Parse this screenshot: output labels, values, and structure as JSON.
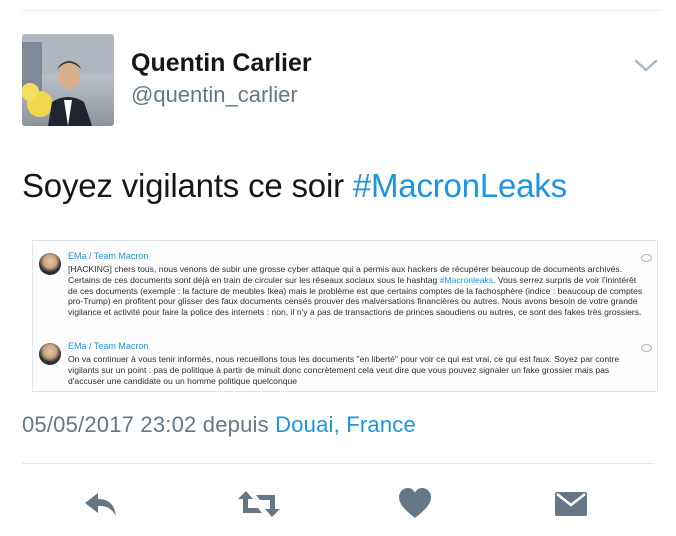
{
  "user": {
    "display_name": "Quentin Carlier",
    "handle": "@quentin_carlier"
  },
  "tweet": {
    "text_before": "Soyez vigilants ce soir ",
    "hashtag": "#MacronLeaks"
  },
  "embedded_messages": [
    {
      "author": "EMa / Team Macron",
      "body_before": "[HACKING] chers tous, nous venons de subir une grosse cyber attaque qui a permis aux hackers de récupérer beaucoup de documents archivés. Certains de ces documents sont déjà en train de circuler sur les réseaux sociaux sous le hashtag ",
      "hashtag": "#Macronleaks",
      "body_after": ". Vous serrez surpris de voir l'inintérêt de ces documents (exemple : la facture de meubles Ikea) mais le problème est que certains comptes de la fachosphère (indice : beaucoup de comptes pro-Trump) en profitent pour glisser des faux documents censés prouver des malversations financières ou autres. Nous avons besoin de votre grande vigilance et activité pour faire la police des internets : non, il n'y a pas de transactions de princes saoudiens ou autres, ce sont des fakes très grossiers."
    },
    {
      "author": "EMa / Team Macron",
      "body": "On va continuer à vous tenir informés, nous recueillons tous les documents \"en liberté\" pour voir ce qui est vrai, ce qui est faux. Soyez par contre vigilants sur un point : pas de politique à partir de minuit donc concrètement cela veut dire que vous pouvez signaler un fake grossier mais pas d'accuser une candidate ou un homme politique quelconque"
    }
  ],
  "meta": {
    "timestamp": "05/05/2017 23:02",
    "via": "depuis",
    "location": "Douai, France"
  },
  "icons": {
    "menu": "chevron-down-icon",
    "reply": "reply-icon",
    "retweet": "retweet-icon",
    "like": "heart-icon",
    "dm": "envelope-icon"
  },
  "colors": {
    "link": "#1b95e0",
    "muted": "#657786",
    "action_icon": "#657786"
  }
}
